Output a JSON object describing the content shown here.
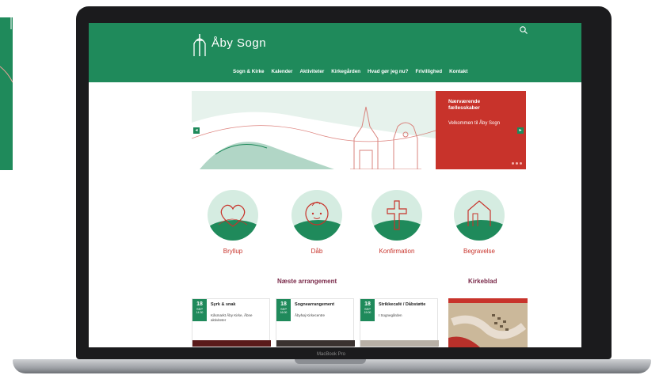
{
  "site": {
    "name": "Åby Sogn",
    "nav": [
      "Sogn & Kirke",
      "Kalender",
      "Aktiviteter",
      "Kirkegården",
      "Hvad gør jeg nu?",
      "Frivillighed",
      "Kontakt"
    ]
  },
  "hero": {
    "heading": "Nærværende fællesskaber",
    "body": "Velkommen til Åby Sogn",
    "prev_arrow": "◂",
    "next_arrow": "▸"
  },
  "services": [
    {
      "label": "Bryllup",
      "icon": "heart-icon"
    },
    {
      "label": "Dåb",
      "icon": "baby-icon"
    },
    {
      "label": "Konfirmation",
      "icon": "cross-icon"
    },
    {
      "label": "Begravelse",
      "icon": "house-icon"
    }
  ],
  "events_title": "Næste arrangement",
  "kirkeblad_title": "Kirkeblad",
  "events": [
    {
      "day": "18",
      "month": "SEP",
      "time": "14:30",
      "title": "Syrk & snak",
      "place": "Kåsmarkt Åby Kirke, Åbne aktiviteter"
    },
    {
      "day": "18",
      "month": "SEP",
      "time": "16:00",
      "title": "Sognearrangement",
      "place": "Åbyhøj Kirkecentre"
    },
    {
      "day": "18",
      "month": "SEP",
      "time": "19:00",
      "title": "Strikkecafé / Dåbstøtte",
      "place": "I Sognegården"
    }
  ],
  "laptop_label": "MacBook Pro",
  "colors": {
    "brand_green": "#1f8a5b",
    "accent_red": "#c8332b",
    "title_plum": "#7a2a4a"
  }
}
